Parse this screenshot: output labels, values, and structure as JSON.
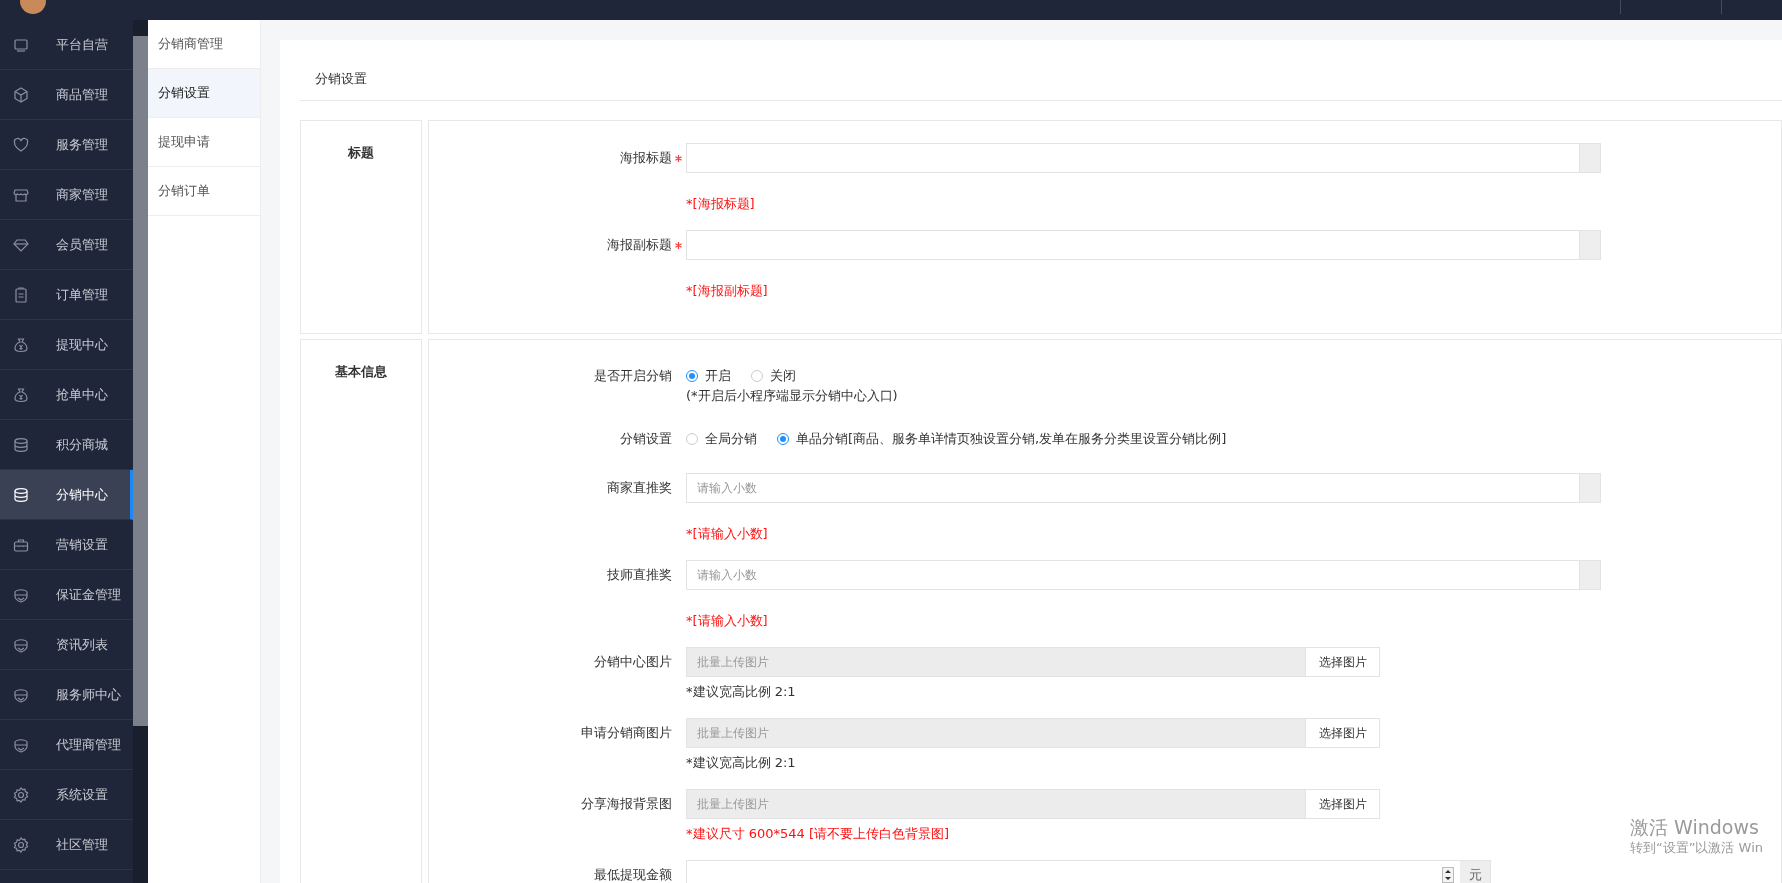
{
  "sidebar": {
    "items": [
      {
        "label": "平台自营",
        "selected": false
      },
      {
        "label": "商品管理",
        "selected": false
      },
      {
        "label": "服务管理",
        "selected": false
      },
      {
        "label": "商家管理",
        "selected": false
      },
      {
        "label": "会员管理",
        "selected": false
      },
      {
        "label": "订单管理",
        "selected": false
      },
      {
        "label": "提现中心",
        "selected": false
      },
      {
        "label": "抢单中心",
        "selected": false
      },
      {
        "label": "积分商城",
        "selected": false
      },
      {
        "label": "分销中心",
        "selected": true
      },
      {
        "label": "营销设置",
        "selected": false
      },
      {
        "label": "保证金管理",
        "selected": false
      },
      {
        "label": "资讯列表",
        "selected": false
      },
      {
        "label": "服务师中心",
        "selected": false
      },
      {
        "label": "代理商管理",
        "selected": false
      },
      {
        "label": "系统设置",
        "selected": false
      },
      {
        "label": "社区管理",
        "selected": false
      }
    ]
  },
  "submenu": {
    "items": [
      {
        "label": "分销商管理",
        "selected": false
      },
      {
        "label": "分销设置",
        "selected": true
      },
      {
        "label": "提现申请",
        "selected": false
      },
      {
        "label": "分销订单",
        "selected": false
      }
    ]
  },
  "page_title": "分销设置",
  "sections": [
    {
      "title": "标题",
      "fields": [
        {
          "kind": "text",
          "label": "海报标题",
          "required": true,
          "hint": "*[海报标题]",
          "warning": true
        },
        {
          "kind": "text",
          "label": "海报副标题",
          "required": true,
          "hint": "*[海报副标题]",
          "warning": true
        }
      ]
    },
    {
      "title": "基本信息",
      "fields": [
        {
          "kind": "radio",
          "label": "是否开启分销",
          "options": [
            {
              "label": "开启",
              "selected": true
            },
            {
              "label": "关闭",
              "selected": false
            }
          ],
          "note": "(*开启后小程序端显示分销中心入口)"
        },
        {
          "kind": "radio",
          "label": "分销设置",
          "options": [
            {
              "label": "全局分销",
              "selected": false
            },
            {
              "label": "单品分销[商品、服务单详情页独设置分销,发单在服务分类里设置分销比例]",
              "selected": true
            }
          ]
        },
        {
          "kind": "text",
          "label": "商家直推奖",
          "required": false,
          "placeholder": "请输入小数",
          "hint": "*[请输入小数]",
          "warning": true
        },
        {
          "kind": "text",
          "label": "技师直推奖",
          "required": false,
          "placeholder": "请输入小数",
          "hint": "*[请输入小数]",
          "warning": true
        },
        {
          "kind": "upload",
          "label": "分销中心图片",
          "placeholder": "批量上传图片",
          "button": "选择图片",
          "hint": "*建议宽高比例 2:1",
          "warning": false
        },
        {
          "kind": "upload",
          "label": "申请分销商图片",
          "placeholder": "批量上传图片",
          "button": "选择图片",
          "hint": "*建议宽高比例 2:1",
          "warning": false
        },
        {
          "kind": "upload",
          "label": "分享海报背景图",
          "placeholder": "批量上传图片",
          "button": "选择图片",
          "hint": "*建议尺寸 600*544 [请不要上传白色背景图]",
          "warning": true
        },
        {
          "kind": "number",
          "label": "最低提现金额",
          "unit": "元"
        }
      ]
    }
  ],
  "windows_notice": {
    "title": "激活 Windows",
    "text": "转到“设置”以激活 Win"
  }
}
